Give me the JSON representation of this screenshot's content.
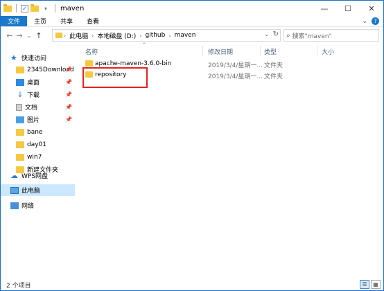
{
  "window": {
    "title": "maven"
  },
  "ribbon": {
    "tabs": [
      "文件",
      "主页",
      "共享",
      "查看"
    ]
  },
  "address": {
    "crumbs": [
      "此电脑",
      "本地磁盘 (D:)",
      "github",
      "maven"
    ]
  },
  "search": {
    "placeholder": "搜索\"maven\""
  },
  "nav": {
    "items": [
      {
        "label": "快速访问",
        "icon": "star-icon",
        "pinned": false
      },
      {
        "label": "2345Download",
        "icon": "folder-icon",
        "pinned": true
      },
      {
        "label": "桌面",
        "icon": "desktop-icon",
        "pinned": true
      },
      {
        "label": "下载",
        "icon": "download-icon",
        "pinned": true
      },
      {
        "label": "文档",
        "icon": "document-icon",
        "pinned": true
      },
      {
        "label": "图片",
        "icon": "picture-icon",
        "pinned": true
      },
      {
        "label": "bane",
        "icon": "folder-icon",
        "pinned": false
      },
      {
        "label": "day01",
        "icon": "folder-icon",
        "pinned": false
      },
      {
        "label": "win7",
        "icon": "folder-icon",
        "pinned": false
      },
      {
        "label": "新建文件夹",
        "icon": "folder-icon",
        "pinned": false
      },
      {
        "label": "WPS网盘",
        "icon": "cloud-icon",
        "pinned": false
      },
      {
        "label": "此电脑",
        "icon": "computer-icon",
        "pinned": false,
        "selected": true
      },
      {
        "label": "网络",
        "icon": "network-icon",
        "pinned": false
      }
    ]
  },
  "columns": {
    "name": "名称",
    "date": "修改日期",
    "type": "类型",
    "size": "大小"
  },
  "files": [
    {
      "name": "apache-maven-3.6.0-bin",
      "date": "2019/3/4/星期一...",
      "type": "文件夹"
    },
    {
      "name": "repository",
      "date": "2019/3/4/星期一...",
      "type": "文件夹"
    }
  ],
  "status": {
    "count": "2 个项目"
  },
  "colors": {
    "accent": "#1979ca",
    "highlight": "#e32222",
    "selected": "#cce8ff"
  }
}
